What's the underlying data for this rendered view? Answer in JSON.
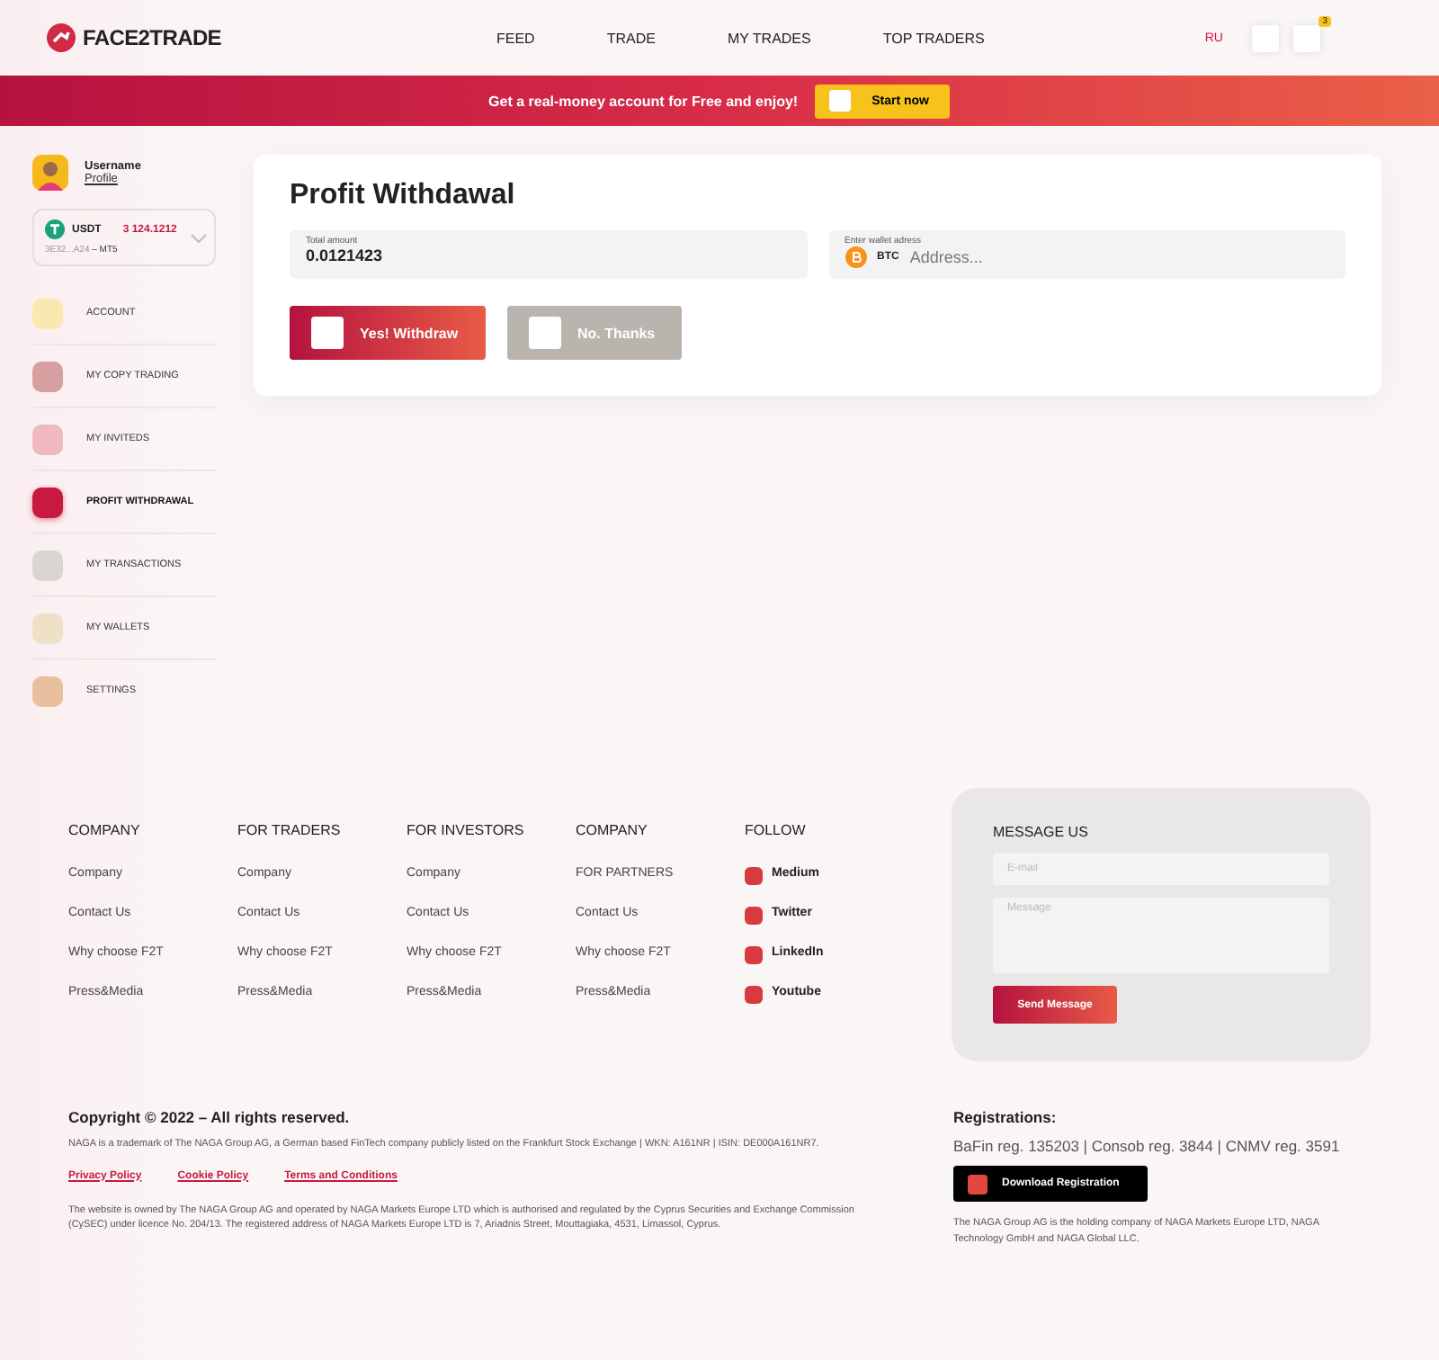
{
  "header": {
    "logo": "FACE2TRADE",
    "nav": [
      {
        "label": "FEED"
      },
      {
        "label": "TRADE"
      },
      {
        "label": "MY TRADES"
      },
      {
        "label": "TOP TRADERS"
      }
    ],
    "language": {
      "label": "RU",
      "active": true
    },
    "notification_count": "3"
  },
  "banner": {
    "text": "Get a real-money account for Free and enjoy!",
    "button": "Start now"
  },
  "profile": {
    "name": "Username",
    "link": "Profile"
  },
  "wallet": {
    "currency": "USDT",
    "balance": "3 124.1212",
    "account": "3E32...A24",
    "platform": "– MT5"
  },
  "sidebar": {
    "items": [
      {
        "label": "ACCOUNT",
        "color": "#fbe7b0",
        "selected": false
      },
      {
        "label": "MY COPY TRADING",
        "color": "#d6a0a0",
        "selected": false
      },
      {
        "label": "MY INVITEDS",
        "color": "#f0b8c0",
        "selected": false
      },
      {
        "label": "PROFIT WITHDRAWAL",
        "color": "#c8193f",
        "selected": true
      },
      {
        "label": "MY TRANSACTIONS",
        "color": "#d9d6d2",
        "selected": false
      },
      {
        "label": "MY WALLETS",
        "color": "#efe1c8",
        "selected": false
      },
      {
        "label": "SETTINGS",
        "color": "#e9c09e",
        "selected": false
      }
    ]
  },
  "withdrawal": {
    "title": "Profit Withdawal",
    "amount_label": "Total amount",
    "amount": "0.0121423",
    "address_label": "Enter wallet adress",
    "coin": "BTC",
    "address_placeholder": "Address...",
    "confirm_button": "Yes! Withdraw",
    "cancel_button": "No. Thanks"
  },
  "footer": {
    "columns": [
      {
        "heading": "COMPANY",
        "links": [
          "Company",
          "Contact Us",
          "Why choose F2T",
          "Press&Media"
        ]
      },
      {
        "heading": "FOR TRADERS",
        "links": [
          "Company",
          "Contact Us",
          "Why choose F2T",
          "Press&Media"
        ]
      },
      {
        "heading": "FOR INVESTORS",
        "links": [
          "Company",
          "Contact Us",
          "Why choose F2T",
          "Press&Media"
        ]
      },
      {
        "heading": "COMPANY",
        "links": [
          "FOR PARTNERS",
          "Contact Us",
          "Why choose F2T",
          "Press&Media"
        ]
      }
    ],
    "follow": {
      "heading": "FOLLOW",
      "links": [
        "Medium",
        "Twitter",
        "LinkedIn",
        "Youtube"
      ]
    },
    "message": {
      "heading": "MESSAGE US",
      "email_placeholder": "E-mail",
      "message_placeholder": "Message",
      "button": "Send Message"
    },
    "copyright": "Copyright © 2022 – All rights reserved.",
    "trademark": "NAGA is a trademark of The NAGA Group AG, a German based FinTech company publicly listed on the Frankfurt Stock Exchange | WKN: A161NR | ISIN: DE000A161NR7.",
    "legal_links": [
      "Privacy Policy",
      "Cookie Policy",
      "Terms and Conditions"
    ],
    "ownership": "The website is owned by The NAGA Group AG and operated by NAGA Markets Europe LTD which is authorised and regulated by the Cyprus Securities and Exchange Commission (CySEC) under licence No. 204/13. The registered address of NAGA Markets Europe LTD is 7, Ariadnis Street, Mouttagiaka, 4531, Limassol, Cyprus.",
    "registrations_heading": "Registrations:",
    "registrations": "BaFin reg. 135203 | Consob reg. 3844 | CNMV reg. 3591",
    "download_button": "Download Registration",
    "holding": "The NAGA Group AG is the holding company of NAGA Markets Europe LTD, NAGA Technology GmbH and NAGA Global LLC."
  }
}
